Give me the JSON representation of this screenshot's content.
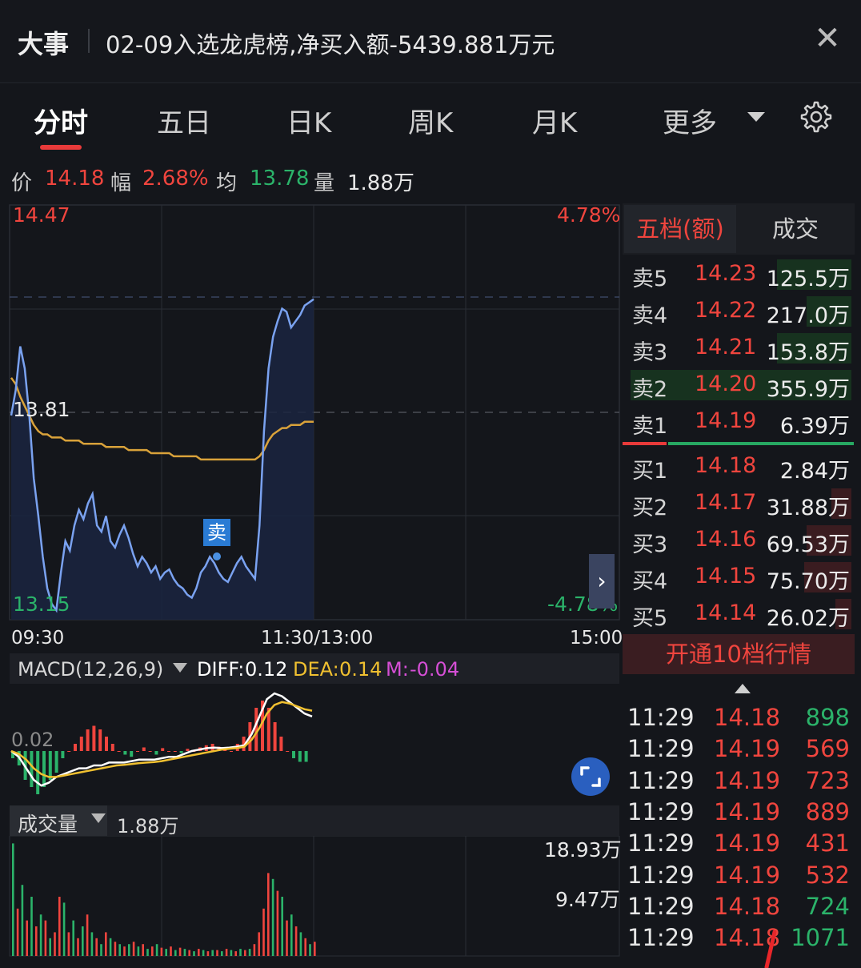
{
  "news": {
    "tag": "大事",
    "text": "02-09入选龙虎榜,净买入额-5439.881万元",
    "close": "✕"
  },
  "tabs": [
    {
      "label": "分时",
      "active": true
    },
    {
      "label": "五日"
    },
    {
      "label": "日K"
    },
    {
      "label": "周K"
    },
    {
      "label": "月K"
    },
    {
      "label": "更多"
    }
  ],
  "info": {
    "price_label": "价",
    "price": "14.18",
    "change_label": "幅",
    "change": "2.68%",
    "avg_label": "均",
    "avg": "13.78",
    "volume_label": "量",
    "volume": "1.88万"
  },
  "intraday": {
    "y_high": "14.47",
    "y_mid": "13.81",
    "y_low": "13.15",
    "pct_high": "4.78%",
    "pct_low": "-4.78%",
    "x_start": "09:30",
    "x_mid": "11:30/13:00",
    "x_end": "15:00",
    "sell_marker": "卖",
    "ylim": [
      13.15,
      14.47
    ],
    "prev_close": 13.81,
    "price": [
      13.8,
      13.88,
      14.02,
      13.95,
      13.8,
      13.6,
      13.48,
      13.35,
      13.25,
      13.2,
      13.18,
      13.3,
      13.4,
      13.37,
      13.45,
      13.5,
      13.47,
      13.52,
      13.55,
      13.45,
      13.43,
      13.48,
      13.4,
      13.38,
      13.42,
      13.45,
      13.41,
      13.36,
      13.32,
      13.35,
      13.33,
      13.3,
      13.32,
      13.28,
      13.3,
      13.31,
      13.28,
      13.26,
      13.25,
      13.23,
      13.22,
      13.25,
      13.3,
      13.32,
      13.35,
      13.33,
      13.3,
      13.28,
      13.27,
      13.3,
      13.33,
      13.35,
      13.32,
      13.3,
      13.28,
      13.45,
      13.75,
      13.95,
      14.05,
      14.1,
      14.14,
      14.13,
      14.08,
      14.1,
      14.12,
      14.15,
      14.16,
      14.17
    ],
    "avg": [
      13.92,
      13.9,
      13.86,
      13.83,
      13.8,
      13.77,
      13.75,
      13.74,
      13.74,
      13.73,
      13.73,
      13.73,
      13.72,
      13.72,
      13.72,
      13.72,
      13.71,
      13.71,
      13.71,
      13.71,
      13.71,
      13.7,
      13.7,
      13.7,
      13.7,
      13.7,
      13.69,
      13.69,
      13.69,
      13.69,
      13.69,
      13.68,
      13.68,
      13.68,
      13.68,
      13.68,
      13.67,
      13.67,
      13.67,
      13.67,
      13.67,
      13.67,
      13.66,
      13.66,
      13.66,
      13.66,
      13.66,
      13.66,
      13.66,
      13.66,
      13.66,
      13.66,
      13.66,
      13.66,
      13.66,
      13.67,
      13.69,
      13.72,
      13.74,
      13.75,
      13.76,
      13.76,
      13.77,
      13.77,
      13.77,
      13.78,
      13.78,
      13.78
    ]
  },
  "macd": {
    "title": "MACD(12,26,9)",
    "diff_label": "DIFF:",
    "diff": "0.12",
    "dea_label": "DEA:",
    "dea": "0.14",
    "m_label": "M:",
    "m": "-0.04",
    "scale": "0.02",
    "bars": [
      -0.01,
      -0.02,
      -0.04,
      -0.05,
      -0.06,
      -0.05,
      -0.04,
      -0.03,
      -0.01,
      0.0,
      0.01,
      0.02,
      0.03,
      0.035,
      0.03,
      0.02,
      0.01,
      0.0,
      -0.005,
      -0.008,
      0.0,
      0.005,
      0.0,
      -0.005,
      0.004,
      0.0,
      0.0,
      -0.003,
      0.003,
      0.0,
      0.005,
      0.008,
      0.01,
      0.006,
      0.004,
      0.0,
      0.01,
      0.02,
      0.04,
      0.06,
      0.07,
      0.06,
      0.04,
      0.02,
      0.0,
      -0.01,
      -0.015,
      -0.015
    ],
    "diff_line": [
      0.0,
      -0.02,
      -0.06,
      -0.1,
      -0.12,
      -0.11,
      -0.09,
      -0.08,
      -0.07,
      -0.06,
      -0.06,
      -0.05,
      -0.05,
      -0.04,
      -0.04,
      -0.04,
      -0.035,
      -0.03,
      -0.03,
      -0.03,
      -0.025,
      -0.02,
      -0.02,
      -0.01,
      0.0,
      0.005,
      0.01,
      0.012,
      0.01,
      0.012,
      0.015,
      0.02,
      0.06,
      0.12,
      0.18,
      0.2,
      0.19,
      0.17,
      0.15,
      0.13,
      0.12
    ],
    "dea_line": [
      0.0,
      -0.01,
      -0.03,
      -0.06,
      -0.08,
      -0.09,
      -0.09,
      -0.085,
      -0.08,
      -0.075,
      -0.07,
      -0.065,
      -0.06,
      -0.055,
      -0.05,
      -0.048,
      -0.045,
      -0.042,
      -0.04,
      -0.038,
      -0.035,
      -0.03,
      -0.025,
      -0.02,
      -0.015,
      -0.01,
      -0.005,
      0.0,
      0.005,
      0.008,
      0.01,
      0.015,
      0.04,
      0.08,
      0.13,
      0.16,
      0.17,
      0.165,
      0.155,
      0.145,
      0.14
    ]
  },
  "volume": {
    "title": "成交量",
    "value": "1.88万",
    "top_label": "18.93万",
    "mid_label": "9.47万",
    "bars": [
      0.95,
      0.4,
      0.6,
      0.3,
      0.5,
      0.25,
      0.35,
      0.3,
      0.15,
      0.2,
      0.5,
      0.45,
      0.2,
      0.3,
      0.15,
      0.25,
      0.35,
      0.2,
      0.15,
      0.1,
      0.2,
      0.15,
      0.12,
      0.1,
      0.08,
      0.1,
      0.12,
      0.08,
      0.1,
      0.06,
      0.08,
      0.1,
      0.07,
      0.06,
      0.08,
      0.05,
      0.07,
      0.06,
      0.05,
      0.04,
      0.06,
      0.05,
      0.04,
      0.05,
      0.05,
      0.04,
      0.06,
      0.05,
      0.04,
      0.06,
      0.05,
      0.06,
      0.1,
      0.2,
      0.4,
      0.7,
      0.65,
      0.55,
      0.5,
      0.3,
      0.35,
      0.25,
      0.2,
      0.15,
      0.1,
      0.12
    ],
    "colors": [
      "g",
      "r",
      "g",
      "r",
      "g",
      "r",
      "g",
      "r",
      "g",
      "r",
      "r",
      "g",
      "r",
      "g",
      "r",
      "g",
      "r",
      "g",
      "r",
      "g",
      "r",
      "g",
      "r",
      "g",
      "r",
      "g",
      "r",
      "g",
      "r",
      "g",
      "r",
      "g",
      "r",
      "g",
      "r",
      "g",
      "r",
      "g",
      "r",
      "g",
      "r",
      "g",
      "r",
      "g",
      "r",
      "g",
      "r",
      "g",
      "r",
      "g",
      "r",
      "g",
      "r",
      "r",
      "r",
      "r",
      "g",
      "r",
      "g",
      "r",
      "g",
      "r",
      "g",
      "r",
      "g",
      "r"
    ]
  },
  "orderbook": {
    "tab_active": "五档(额)",
    "tab_other": "成交",
    "sells": [
      {
        "label": "卖5",
        "price": "14.23",
        "vol": "125.5万",
        "fill": 0.33
      },
      {
        "label": "卖4",
        "price": "14.22",
        "vol": "217.0万",
        "fill": 0.2
      },
      {
        "label": "卖3",
        "price": "14.21",
        "vol": "153.8万",
        "fill": 0.33
      },
      {
        "label": "卖2",
        "price": "14.20",
        "vol": "355.9万",
        "fill": 0.98
      },
      {
        "label": "卖1",
        "price": "14.19",
        "vol": "6.39万",
        "fill": 0.0
      }
    ],
    "buys": [
      {
        "label": "买1",
        "price": "14.18",
        "vol": "2.84万",
        "fill": 0.0
      },
      {
        "label": "买2",
        "price": "14.17",
        "vol": "31.88万",
        "fill": 0.09
      },
      {
        "label": "买3",
        "price": "14.16",
        "vol": "69.53万",
        "fill": 0.2
      },
      {
        "label": "买4",
        "price": "14.15",
        "vol": "75.70万",
        "fill": 0.21
      },
      {
        "label": "买5",
        "price": "14.14",
        "vol": "26.02万",
        "fill": 0.07
      }
    ],
    "open10_label": "开通10档行情"
  },
  "ticks": [
    {
      "time": "11:29",
      "price": "14.18",
      "vol": "898",
      "pc": "red",
      "vc": "green"
    },
    {
      "time": "11:29",
      "price": "14.19",
      "vol": "569",
      "pc": "red",
      "vc": "red"
    },
    {
      "time": "11:29",
      "price": "14.19",
      "vol": "723",
      "pc": "red",
      "vc": "red"
    },
    {
      "time": "11:29",
      "price": "14.19",
      "vol": "889",
      "pc": "red",
      "vc": "red"
    },
    {
      "time": "11:29",
      "price": "14.19",
      "vol": "431",
      "pc": "red",
      "vc": "red"
    },
    {
      "time": "11:29",
      "price": "14.19",
      "vol": "532",
      "pc": "red",
      "vc": "red"
    },
    {
      "time": "11:29",
      "price": "14.18",
      "vol": "724",
      "pc": "red",
      "vc": "green"
    },
    {
      "time": "11:29",
      "price": "14.18",
      "vol": "1071",
      "pc": "red",
      "vc": "green"
    }
  ],
  "colors": {
    "up": "#f0453e",
    "down": "#2bb36a",
    "price_line": "#7aa2f0",
    "avg_line": "#d9a23a",
    "diff_line": "#ffffff",
    "dea_line": "#f0c030",
    "m_text": "#d64fd6",
    "accent": "#e83a3a"
  },
  "icons": {
    "gear": "gear-icon",
    "dropdown": "chevron-down-icon",
    "expand": "expand-icon",
    "arrow": "chevron-right-icon"
  }
}
